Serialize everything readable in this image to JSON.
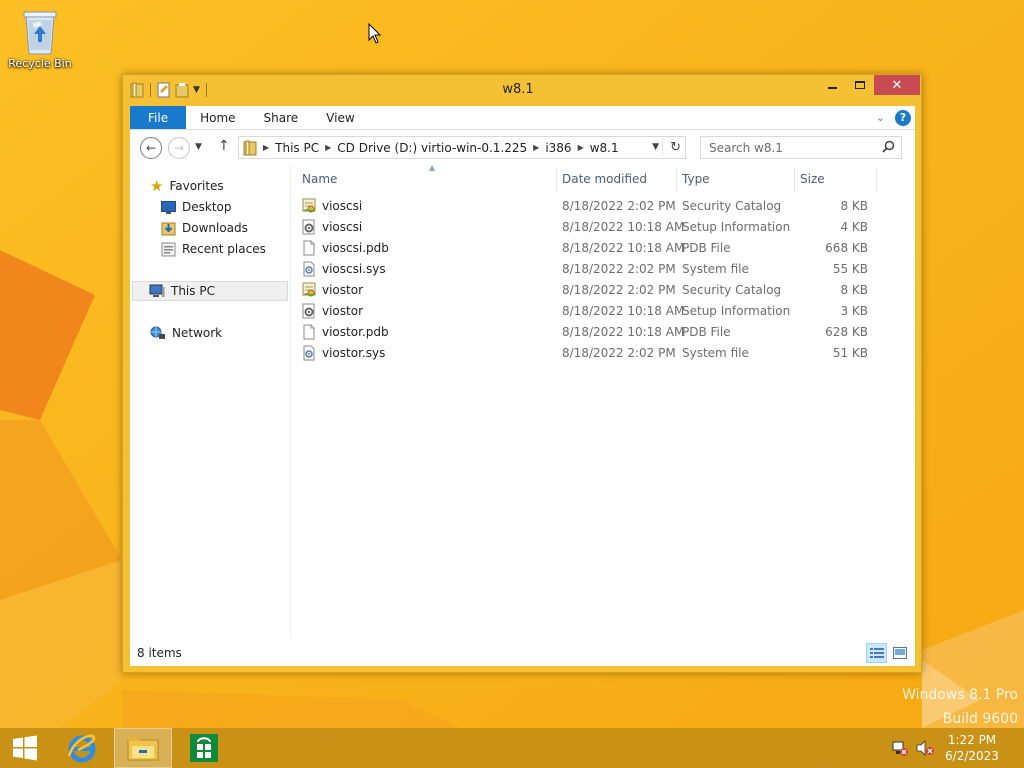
{
  "desktop": {
    "recycle_bin_label": "Recycle Bin",
    "watermark_line1": "Windows 8.1 Pro",
    "watermark_line2": "Build 9600"
  },
  "window": {
    "title": "w8.1",
    "ribbon_tabs": [
      {
        "label": "File",
        "active": true
      },
      {
        "label": "Home"
      },
      {
        "label": "Share"
      },
      {
        "label": "View"
      }
    ],
    "address": {
      "crumbs": [
        "This PC",
        "CD Drive (D:) virtio-win-0.1.225",
        "i386",
        "w8.1"
      ]
    },
    "search": {
      "placeholder": "Search w8.1"
    },
    "nav_pane": {
      "favorites": "Favorites",
      "favorites_items": [
        "Desktop",
        "Downloads",
        "Recent places"
      ],
      "this_pc": "This PC",
      "network": "Network"
    },
    "columns": {
      "name": "Name",
      "date": "Date modified",
      "type": "Type",
      "size": "Size"
    },
    "files": [
      {
        "name": "vioscsi",
        "date": "8/18/2022 2:02 PM",
        "type": "Security Catalog",
        "size": "8 KB",
        "icon": "security-catalog-icon"
      },
      {
        "name": "vioscsi",
        "date": "8/18/2022 10:18 AM",
        "type": "Setup Information",
        "size": "4 KB",
        "icon": "setup-information-icon"
      },
      {
        "name": "vioscsi.pdb",
        "date": "8/18/2022 10:18 AM",
        "type": "PDB File",
        "size": "668 KB",
        "icon": "pdb-file-icon"
      },
      {
        "name": "vioscsi.sys",
        "date": "8/18/2022 2:02 PM",
        "type": "System file",
        "size": "55 KB",
        "icon": "system-file-icon"
      },
      {
        "name": "viostor",
        "date": "8/18/2022 2:02 PM",
        "type": "Security Catalog",
        "size": "8 KB",
        "icon": "security-catalog-icon"
      },
      {
        "name": "viostor",
        "date": "8/18/2022 10:18 AM",
        "type": "Setup Information",
        "size": "3 KB",
        "icon": "setup-information-icon"
      },
      {
        "name": "viostor.pdb",
        "date": "8/18/2022 10:18 AM",
        "type": "PDB File",
        "size": "628 KB",
        "icon": "pdb-file-icon"
      },
      {
        "name": "viostor.sys",
        "date": "8/18/2022 2:02 PM",
        "type": "System file",
        "size": "51 KB",
        "icon": "system-file-icon"
      }
    ],
    "status": "8 items"
  },
  "taskbar": {
    "time": "1:22 PM",
    "date": "6/2/2023"
  },
  "colors": {
    "accent": "#1979ca",
    "wallpaper": "#f7b21a",
    "close": "#c74b50"
  }
}
